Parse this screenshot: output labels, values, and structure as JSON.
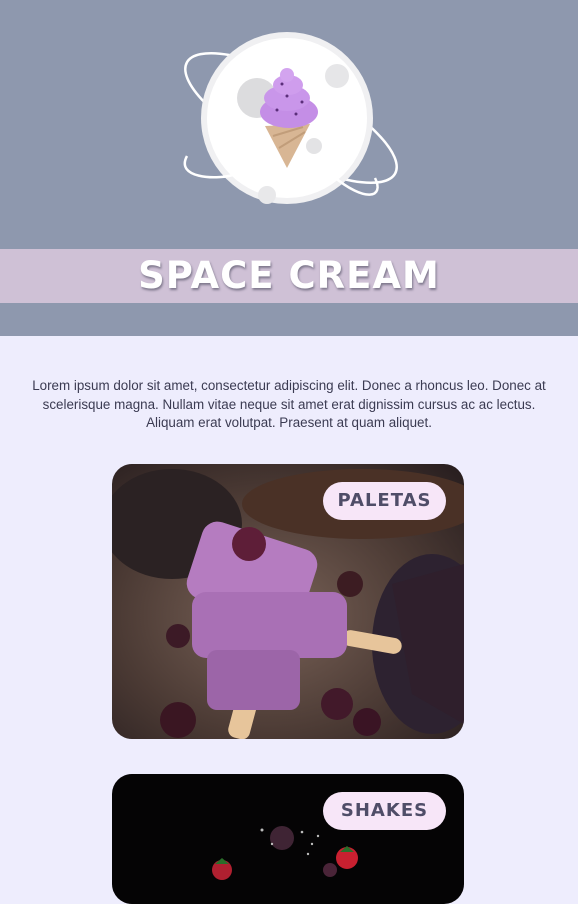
{
  "brand": {
    "title": "SPACE CREAM"
  },
  "intro": {
    "text": "Lorem ipsum dolor sit amet, consectetur adipiscing elit. Donec a rhoncus leo. Donec at scelerisque magna. Nullam vitae neque sit amet erat dignissim cursus ac ac lectus. Aliquam erat volutpat. Praesent at quam aliquet."
  },
  "products": [
    {
      "label": "PALETAS",
      "image": "purple-ice-pops-with-blackberries"
    },
    {
      "label": "SHAKES",
      "image": "berries-on-black-background"
    }
  ],
  "colors": {
    "header_bg": "#8e98ae",
    "title_band": "#cfc1d6",
    "page_bg": "#eeedfd",
    "label_bg": "#f7e6f8",
    "label_text": "#4f4d68"
  },
  "icons": [
    "planet-ice-cream-logo-icon"
  ]
}
